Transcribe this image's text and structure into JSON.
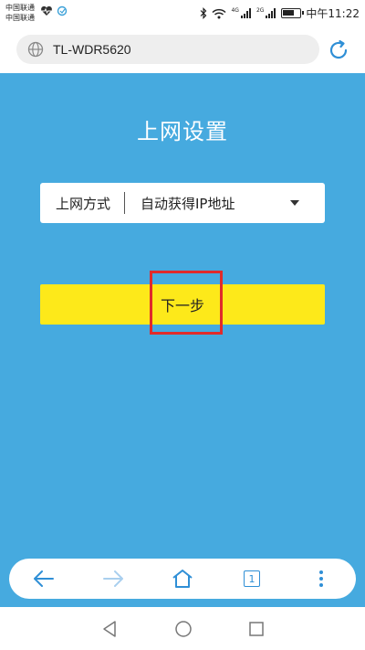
{
  "status_bar": {
    "carrier_1": "中国联通",
    "carrier_2": "中国联通",
    "signal_1_label": "4G",
    "signal_2_label": "2G",
    "battery_level": 0.7,
    "time": "中午11:22"
  },
  "url_bar": {
    "url": "TL-WDR5620"
  },
  "page": {
    "title": "上网设置",
    "connection_type": {
      "label": "上网方式",
      "value": "自动获得IP地址"
    },
    "next_button": "下一步"
  },
  "toolbar": {
    "tab_count": "1"
  },
  "colors": {
    "background": "#46aadf",
    "button": "#fde91a",
    "highlight": "#e02b2b",
    "accent": "#2f8fd6"
  }
}
